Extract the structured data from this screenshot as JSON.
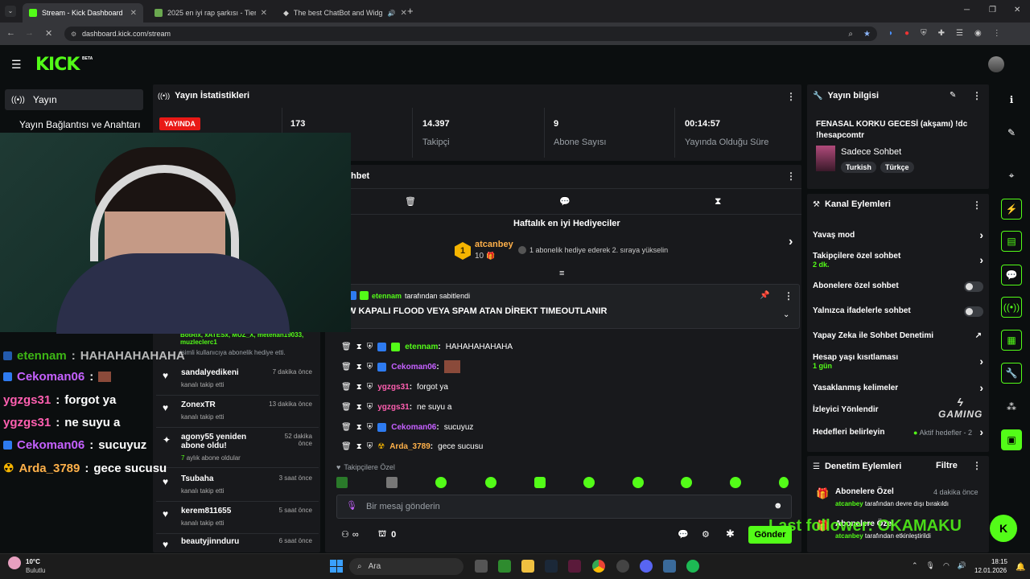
{
  "browser": {
    "tabs": [
      {
        "title": "Stream - Kick Dashboard",
        "active": true
      },
      {
        "title": "2025 en iyi rap şarkısı - Tier List",
        "active": false
      },
      {
        "title": "The best ChatBot and Widg",
        "active": false
      }
    ],
    "url": "dashboard.kick.com/stream"
  },
  "kick": {
    "logo": "KICK",
    "beta": "BETA"
  },
  "left_nav": {
    "section": "Yayın",
    "item": "Yayın Bağlantısı ve Anahtarı"
  },
  "stats": {
    "title": "Yayın İstatistikleri",
    "live_badge": "YAYINDA",
    "items": [
      {
        "value": "173",
        "label": ""
      },
      {
        "value": "14.397",
        "label": "Takipçi"
      },
      {
        "value": "9",
        "label": "Abone Sayısı"
      },
      {
        "value": "00:14:57",
        "label": "Yayında Olduğu Süre"
      }
    ]
  },
  "chat": {
    "title": "hbet",
    "leaderboard_title": "Haftalık en iyi Hediyeciler",
    "top_gifter": {
      "rank": "1",
      "name": "atcanbey",
      "count": "10",
      "note": "1 abonelik hediye ederek 2. sıraya yükselin"
    },
    "pinned_by_user": "etennam",
    "pinned_by_suffix": "tarafından sabitlendi",
    "pinned_text": "W KAPALI FLOOD VEYA SPAM ATAN DİREKT TIMEOUTLANIR",
    "messages": [
      {
        "user": "etennam",
        "color": "#53fc18",
        "text": "HAHAHAHAHAHA"
      },
      {
        "user": "Cekoman06",
        "color": "#c561ff",
        "text": ""
      },
      {
        "user": "ygzgs31",
        "color": "#ff5fb0",
        "text": "forgot ya"
      },
      {
        "user": "ygzgs31",
        "color": "#ff5fb0",
        "text": "ne suyu a"
      },
      {
        "user": "Cekoman06",
        "color": "#c561ff",
        "text": "sucuyuz"
      },
      {
        "user": "Arda_3789",
        "color": "#ffb14a",
        "text": "gece sucusu"
      }
    ],
    "mode_label": "Takipçilere Özel",
    "input_placeholder": "Bir mesaj gönderin",
    "points": "0",
    "send_label": "Gönder"
  },
  "overlay_chat": [
    {
      "user": "etennam",
      "color": "#53fc18",
      "text": "HAHAHAHAHAHA"
    },
    {
      "user": "Cekoman06",
      "color": "#c561ff",
      "text": ""
    },
    {
      "user": "ygzgs31",
      "color": "#ff5fb0",
      "text": "forgot ya"
    },
    {
      "user": "ygzgs31",
      "color": "#ff5fb0",
      "text": "ne suyu a"
    },
    {
      "user": "Cekoman06",
      "color": "#c561ff",
      "text": "sucuyuz"
    },
    {
      "user": "Arda_3789",
      "color": "#ffb14a",
      "text": "gece sucusu"
    }
  ],
  "activity": {
    "gift_names": "BotRix, xATESx, MUZ_X, metehan19033, muzleclerc1",
    "gift_note": "isimli kullanıcıya abonelik hediye etti.",
    "items": [
      {
        "icon": "heart",
        "name": "sandalyedikeni",
        "sub": "kanalı takip etti",
        "time": "7 dakika önce"
      },
      {
        "icon": "heart",
        "name": "ZonexTR",
        "sub": "kanalı takip etti",
        "time": "13 dakika önce"
      },
      {
        "icon": "star",
        "name": "agony55 yeniden abone oldu!",
        "sub_num": "7",
        "sub": "aylık abone oldular",
        "time": "52 dakika önce"
      },
      {
        "icon": "heart",
        "name": "Tsubaha",
        "sub": "kanalı takip etti",
        "time": "3 saat önce"
      },
      {
        "icon": "heart",
        "name": "kerem811655",
        "sub": "kanalı takip etti",
        "time": "5 saat önce"
      },
      {
        "icon": "heart",
        "name": "beautyjinnduru",
        "sub": "",
        "time": "6 saat önce"
      }
    ]
  },
  "stream_info": {
    "title": "Yayın bilgisi",
    "stream_title": "FENASAL KORKU GECESİ (akşamı) !dc !hesapcomtr",
    "category": "Sadece Sohbet",
    "tags": [
      "Turkish",
      "Türkçe"
    ]
  },
  "channel_actions": {
    "title": "Kanal Eylemleri",
    "rows": [
      {
        "label": "Yavaş mod",
        "sub": "",
        "ctrl": "chev"
      },
      {
        "label": "Takipçilere özel sohbet",
        "sub": "2 dk.",
        "ctrl": "chev"
      },
      {
        "label": "Abonelere özel sohbet",
        "sub": "",
        "ctrl": "toggle"
      },
      {
        "label": "Yalnızca ifadelerle sohbet",
        "sub": "",
        "ctrl": "toggle"
      },
      {
        "label": "Yapay Zeka ile Sohbet Denetimi",
        "sub": "",
        "ctrl": "ext"
      },
      {
        "label": "Hesap yaşı kısıtlaması",
        "sub": "1 gün",
        "ctrl": "chev"
      },
      {
        "label": "Yasaklanmış kelimeler",
        "sub": "",
        "ctrl": "chev"
      },
      {
        "label": "İzleyici Yönlendir",
        "sub": "",
        "ctrl": "none"
      },
      {
        "label": "Hedefleri belirleyin",
        "sub": "",
        "ctrl": "chev"
      }
    ],
    "goal_status": "Aktif hedefler - 2"
  },
  "moderation": {
    "title": "Denetim Eylemleri",
    "filter": "Filtre",
    "items": [
      {
        "label": "Abonelere Özel",
        "time": "4 dakika önce",
        "user": "atcanbey",
        "action": "tarafından devre dışı bırakıldı"
      },
      {
        "label": "Abonelere Özel",
        "time": "",
        "user": "atcanbey",
        "action": "tarafından etkinleştirildi"
      }
    ]
  },
  "watermark": {
    "brand": "GAMING"
  },
  "last_follower": "Last follower: OKAMAKU",
  "weather": {
    "temp": "10°C",
    "desc": "Bulutlu"
  },
  "taskbar": {
    "search": "Ara",
    "time": "18:15",
    "date": "12.01.2026"
  },
  "colors": {
    "accent": "#53fc18",
    "bg": "#0b0e0f",
    "panel": "#18191c",
    "live": "#e91916"
  }
}
